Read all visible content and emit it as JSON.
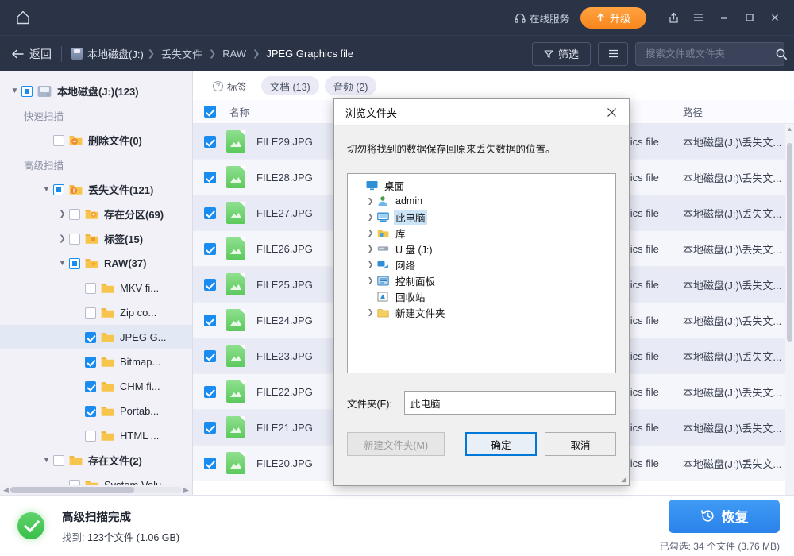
{
  "titlebar": {
    "home_icon": "home-icon",
    "online_service_label": "在线服务",
    "online_service_icon": "headset-icon",
    "upgrade_label": "升级",
    "upgrade_icon": "arrow-up-icon",
    "share_icon": "share-icon",
    "menu_icon": "hamburger-menu-icon",
    "minimize_icon": "minimize-icon",
    "maximize_icon": "maximize-icon",
    "close_icon": "close-icon",
    "accent_orange": "#f8861d",
    "bar_bg": "#2b3347"
  },
  "navbar": {
    "back_label": "返回",
    "back_icon": "arrow-left-icon",
    "breadcrumbs": [
      {
        "label": "本地磁盘(J:)",
        "icon": "disk-icon"
      },
      {
        "label": "丢失文件"
      },
      {
        "label": "RAW"
      },
      {
        "label": "JPEG Graphics file"
      }
    ],
    "filter_label": "筛选",
    "filter_icon": "funnel-icon",
    "view_icon": "list-view-icon",
    "search_placeholder": "搜索文件或文件夹",
    "search_value": "",
    "search_icon": "search-icon"
  },
  "sidebar": {
    "items": [
      {
        "label": "本地磁盘(J:)(123)",
        "indent": 0,
        "twist": "▼",
        "check": "partial",
        "icon": "harddisk-icon",
        "bold": true,
        "type": "node"
      },
      {
        "label": "快速扫描",
        "indent": 1,
        "type": "section"
      },
      {
        "label": "删除文件(0)",
        "indent": 2,
        "twist": "",
        "check": "none",
        "icon": "folder-minus-icon",
        "bold": true,
        "type": "node"
      },
      {
        "label": "高级扫描",
        "indent": 1,
        "type": "section"
      },
      {
        "label": "丢失文件(121)",
        "indent": 2,
        "twist": "▼",
        "check": "partial",
        "icon": "folder-alert-icon",
        "bold": true,
        "type": "node"
      },
      {
        "label": "存在分区(69)",
        "indent": 3,
        "twist": "❯",
        "check": "none",
        "icon": "folder-partition-icon",
        "bold": true,
        "type": "node"
      },
      {
        "label": "标签(15)",
        "indent": 3,
        "twist": "❯",
        "check": "none",
        "icon": "folder-tag-icon",
        "bold": true,
        "type": "node"
      },
      {
        "label": "RAW(37)",
        "indent": 3,
        "twist": "▼",
        "check": "partial",
        "icon": "folder-star-icon",
        "bold": true,
        "type": "node"
      },
      {
        "label": "MKV fi...",
        "indent": 4,
        "twist": "",
        "check": "none",
        "icon": "folder-icon",
        "type": "node"
      },
      {
        "label": "Zip co...",
        "indent": 4,
        "twist": "",
        "check": "none",
        "icon": "folder-icon",
        "type": "node"
      },
      {
        "label": "JPEG G...",
        "indent": 4,
        "twist": "",
        "check": "checked",
        "icon": "folder-icon",
        "type": "node",
        "selected": true
      },
      {
        "label": "Bitmap...",
        "indent": 4,
        "twist": "",
        "check": "checked",
        "icon": "folder-icon",
        "type": "node"
      },
      {
        "label": "CHM fi...",
        "indent": 4,
        "twist": "",
        "check": "checked",
        "icon": "folder-icon",
        "type": "node"
      },
      {
        "label": "Portab...",
        "indent": 4,
        "twist": "",
        "check": "checked",
        "icon": "folder-icon",
        "type": "node"
      },
      {
        "label": "HTML ...",
        "indent": 4,
        "twist": "",
        "check": "none",
        "icon": "folder-icon",
        "type": "node"
      },
      {
        "label": "存在文件(2)",
        "indent": 2,
        "twist": "▼",
        "check": "none",
        "icon": "folder-icon",
        "bold": true,
        "type": "node"
      },
      {
        "label": "System Volu...",
        "indent": 3,
        "twist": "",
        "check": "none",
        "icon": "folder-icon",
        "type": "node"
      }
    ]
  },
  "filepanel": {
    "tabs": [
      {
        "label": "标签",
        "icon": "question-circle-icon",
        "chip": false
      },
      {
        "label": "文档 (13)",
        "chip": true
      },
      {
        "label": "音频 (2)",
        "chip": true
      }
    ],
    "columns": {
      "name": "名称",
      "type": "",
      "path": "路径"
    },
    "header_checked": true,
    "rows": [
      {
        "name": "FILE29.JPG",
        "type": "JPEG Graphics file",
        "path": "本地磁盘(J:)\\丢失文...",
        "checked": true
      },
      {
        "name": "FILE28.JPG",
        "type": "JPEG Graphics file",
        "path": "本地磁盘(J:)\\丢失文...",
        "checked": true
      },
      {
        "name": "FILE27.JPG",
        "type": "JPEG Graphics file",
        "path": "本地磁盘(J:)\\丢失文...",
        "checked": true
      },
      {
        "name": "FILE26.JPG",
        "type": "JPEG Graphics file",
        "path": "本地磁盘(J:)\\丢失文...",
        "checked": true
      },
      {
        "name": "FILE25.JPG",
        "type": "JPEG Graphics file",
        "path": "本地磁盘(J:)\\丢失文...",
        "checked": true
      },
      {
        "name": "FILE24.JPG",
        "type": "JPEG Graphics file",
        "path": "本地磁盘(J:)\\丢失文...",
        "checked": true
      },
      {
        "name": "FILE23.JPG",
        "type": "JPEG Graphics file",
        "path": "本地磁盘(J:)\\丢失文...",
        "checked": true
      },
      {
        "name": "FILE22.JPG",
        "type": "JPEG Graphics file",
        "path": "本地磁盘(J:)\\丢失文...",
        "checked": true
      },
      {
        "name": "FILE21.JPG",
        "type": "JPEG Graphics file",
        "path": "本地磁盘(J:)\\丢失文...",
        "checked": true
      },
      {
        "name": "FILE20.JPG",
        "type": "JPEG Graphics file",
        "path": "本地磁盘(J:)\\丢失文...",
        "checked": true
      }
    ]
  },
  "statusbar": {
    "status_icon": "success-check-icon",
    "title": "高级扫描完成",
    "found_label": "找到:",
    "found_value": "123个文件 (1.06 GB)",
    "recover_label": "恢复",
    "recover_icon": "restore-clock-icon",
    "selected_label": "已勾选:",
    "selected_value": "34 个文件 (3.76 MB)"
  },
  "modal": {
    "title": "浏览文件夹",
    "close_icon": "close-icon",
    "description": "切勿将找到的数据保存回原来丢失数据的位置。",
    "tree": [
      {
        "label": "桌面",
        "indent": 0,
        "arrow": "",
        "icon": "desktop-icon",
        "selected": false
      },
      {
        "label": "admin",
        "indent": 1,
        "arrow": "❯",
        "icon": "user-icon"
      },
      {
        "label": "此电脑",
        "indent": 1,
        "arrow": "❯",
        "icon": "computer-icon",
        "selected": true
      },
      {
        "label": "库",
        "indent": 1,
        "arrow": "❯",
        "icon": "library-icon"
      },
      {
        "label": "U 盘 (J:)",
        "indent": 1,
        "arrow": "❯",
        "icon": "usb-drive-icon"
      },
      {
        "label": "网络",
        "indent": 1,
        "arrow": "❯",
        "icon": "network-icon"
      },
      {
        "label": "控制面板",
        "indent": 1,
        "arrow": "❯",
        "icon": "control-panel-icon"
      },
      {
        "label": "回收站",
        "indent": 1,
        "arrow": "",
        "icon": "recycle-bin-icon"
      },
      {
        "label": "新建文件夹",
        "indent": 1,
        "arrow": "❯",
        "icon": "folder-icon"
      }
    ],
    "folder_label": "文件夹(F):",
    "folder_value": "此电脑",
    "new_folder_label": "新建文件夹(M)",
    "ok_label": "确定",
    "cancel_label": "取消"
  }
}
